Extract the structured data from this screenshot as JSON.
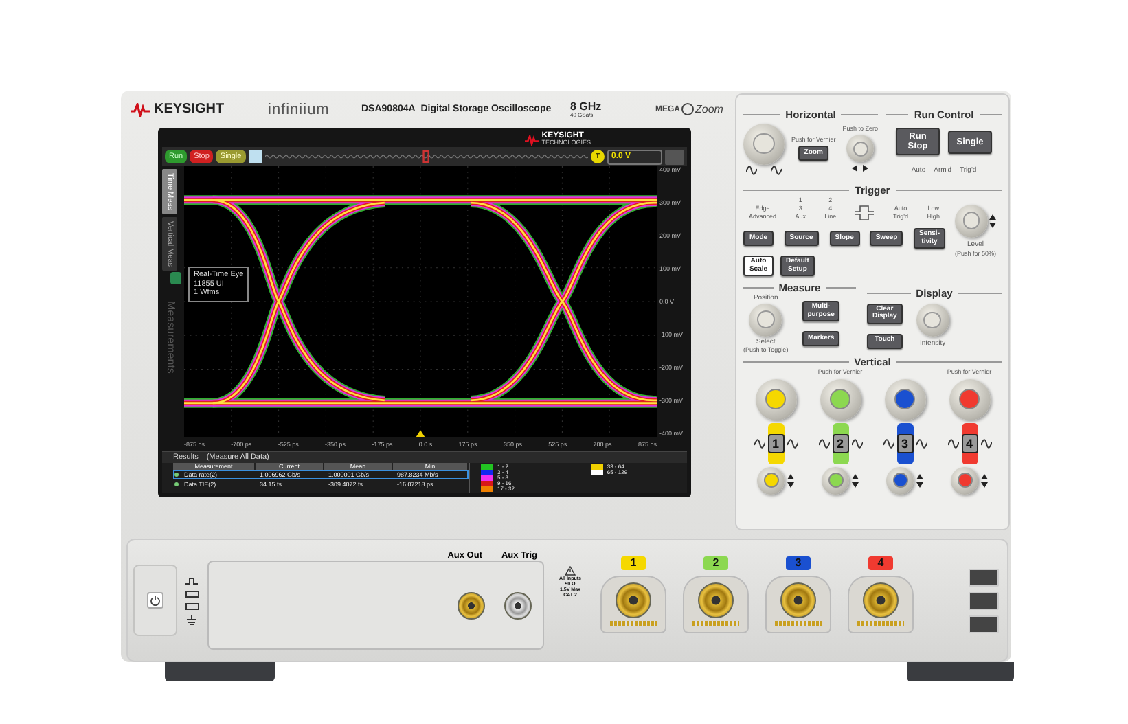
{
  "header": {
    "brand": "KEYSIGHT",
    "series": "infiniium",
    "model": "DSA90804A",
    "description": "Digital Storage Oscilloscope",
    "bandwidth": "8 GHz",
    "sample_rate": "40 GSa/s",
    "mega": "MEGA",
    "zoom": "Zoom"
  },
  "screen": {
    "logo": {
      "brand": "KEYSIGHT",
      "sub": "TECHNOLOGIES"
    },
    "run_buttons": [
      {
        "label": "Run",
        "kind": "run"
      },
      {
        "label": "Stop",
        "kind": "stop"
      },
      {
        "label": "Single",
        "kind": "single"
      }
    ],
    "trigger_badge": "T",
    "trigger_level": "0.0 V",
    "side_tabs": [
      {
        "label": "Time Meas",
        "selected": true
      },
      {
        "label": "Vertical Meas",
        "selected": false
      }
    ],
    "side_label": "Measurements",
    "y_labels": [
      "400 mV",
      "300 mV",
      "200 mV",
      "100 mV",
      "0.0 V",
      "-100 mV",
      "-200 mV",
      "-300 mV",
      "-400 mV"
    ],
    "x_labels": [
      "-875 ps",
      "-700 ps",
      "-525 ps",
      "-350 ps",
      "-175 ps",
      "0.0 s",
      "175 ps",
      "350 ps",
      "525 ps",
      "700 ps",
      "875 ps"
    ],
    "info": [
      "Real-Time Eye",
      "11855 UI",
      "1 Wfms"
    ],
    "results": {
      "title": "Results",
      "scope": "(Measure All Data)",
      "columns": [
        "Measurement",
        "Current",
        "Mean",
        "Min"
      ],
      "rows": [
        {
          "cells": [
            "Data rate(2)",
            "1.006962 Gb/s",
            "1.000001 Gb/s",
            "987.8234 Mb/s"
          ],
          "selected": true
        },
        {
          "cells": [
            "Data TIE(2)",
            "34.15 fs",
            "-309.4072 fs",
            "-16.07218 ps"
          ],
          "selected": false
        }
      ]
    },
    "legend": [
      {
        "label": "1 - 2",
        "color": "#22c322"
      },
      {
        "label": "3 - 4",
        "color": "#1428f0"
      },
      {
        "label": "5 - 8",
        "color": "#f030f0"
      },
      {
        "label": "9 - 16",
        "color": "#d81818"
      },
      {
        "label": "17 - 32",
        "color": "#f08000"
      },
      {
        "label": "33 - 64",
        "color": "#f0d000"
      },
      {
        "label": "65 - 129",
        "color": "#ffffff"
      }
    ]
  },
  "panel": {
    "horizontal": {
      "title": "Horizontal",
      "knob_hint": "Push for Vernier",
      "zoom_button": "Zoom",
      "knob2_hint": "Push to Zero"
    },
    "run_control": {
      "title": "Run Control",
      "buttons": [
        [
          "Run",
          "Stop"
        ],
        [
          "Single"
        ]
      ],
      "indicators": [
        "Auto",
        "Arm'd",
        "Trig'd"
      ]
    },
    "trigger": {
      "title": "Trigger",
      "columns": [
        {
          "kind": "text",
          "lines": [
            "Edge",
            "Advanced"
          ]
        },
        {
          "kind": "text",
          "lines": [
            "1",
            "3",
            "Aux"
          ]
        },
        {
          "kind": "text",
          "lines": [
            "2",
            "4",
            "Line"
          ]
        },
        {
          "kind": "slope"
        },
        {
          "kind": "text",
          "lines": [
            "Auto",
            "Trig'd"
          ]
        },
        {
          "kind": "text",
          "lines": [
            "Low",
            "High"
          ]
        }
      ],
      "buttons": [
        [
          "Mode"
        ],
        [
          "Source"
        ],
        [
          "Slope"
        ],
        [
          "Sweep"
        ],
        [
          "Sensi-",
          "tivity"
        ]
      ],
      "level": "Level",
      "level_hint": "(Push for 50%)",
      "setup_buttons": [
        {
          "lines": [
            "Auto",
            "Scale"
          ],
          "kind": "light"
        },
        {
          "lines": [
            "Default",
            "Setup"
          ],
          "kind": "dark"
        }
      ]
    },
    "measure": {
      "title": "Measure",
      "position": "Position",
      "select": "Select",
      "select_hint": "(Push to Toggle)",
      "buttons": [
        [
          "Multi-",
          "purpose"
        ],
        [
          "Markers"
        ]
      ]
    },
    "display": {
      "title": "Display",
      "buttons": [
        [
          "Clear",
          "Display"
        ],
        [
          "Touch"
        ]
      ],
      "intensity": "Intensity"
    },
    "vertical": {
      "title": "Vertical",
      "channels": [
        {
          "label": "1",
          "color": "#f5d800"
        },
        {
          "label": "2",
          "color": "#8cd850",
          "hint": "Push for Vernier"
        },
        {
          "label": "3",
          "color": "#1a50d0"
        },
        {
          "label": "4",
          "color": "#f03a30",
          "hint": "Push for Vernier"
        }
      ]
    }
  },
  "front": {
    "aux": [
      "Aux Out",
      "Aux Trig"
    ],
    "warning": [
      "All Inputs",
      "50 Ω",
      "1.5V Max",
      "CAT 2"
    ],
    "inputs": [
      {
        "label": "1",
        "color": "#f5d800"
      },
      {
        "label": "2",
        "color": "#8cd850"
      },
      {
        "label": "3",
        "color": "#1a50d0"
      },
      {
        "label": "4",
        "color": "#f03a30"
      }
    ]
  }
}
